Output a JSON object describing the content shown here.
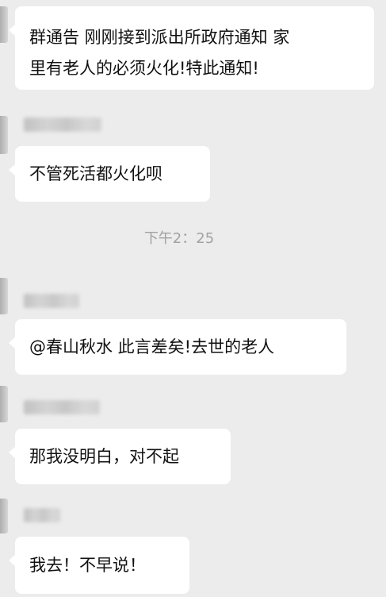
{
  "chat": {
    "timestamp": "下午2：25",
    "messages": [
      {
        "text_line1": "群通告 刚刚接到派出所政府通知 家",
        "text_line2": "里有老人的必须火化!特此通知!"
      },
      {
        "text": "不管死活都火化呗"
      },
      {
        "text": "@春山秋水 此言差矣!去世的老人"
      },
      {
        "text": "那我没明白，对不起"
      },
      {
        "text": "我去！不早说！"
      }
    ]
  }
}
